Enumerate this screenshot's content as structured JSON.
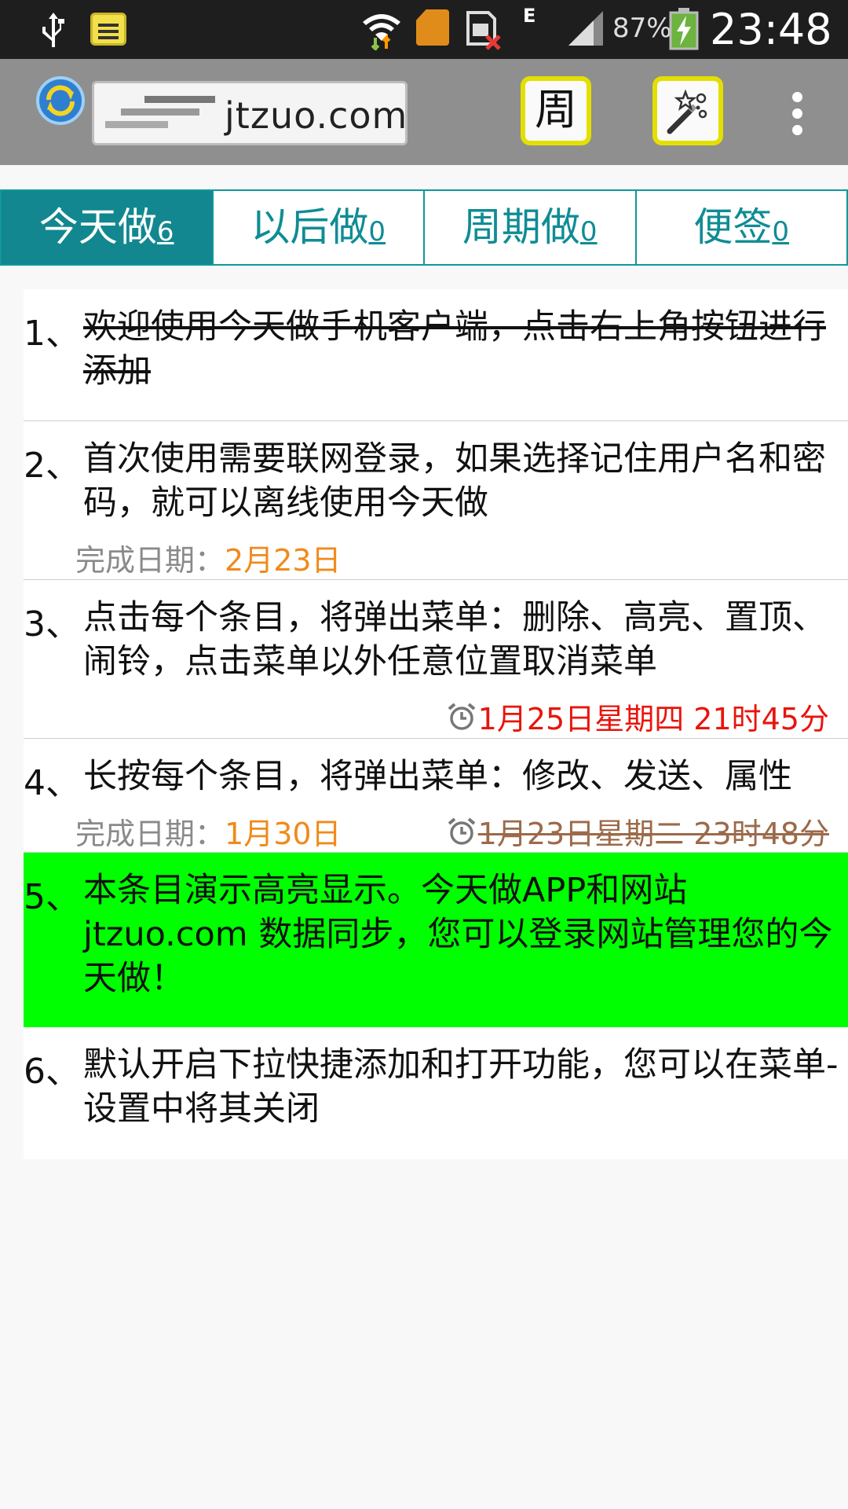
{
  "statusbar": {
    "network_type": "E",
    "battery_percent": "87%",
    "time": "23:48"
  },
  "appbar": {
    "site_name": "jtzuo.com",
    "week_button_label": "周"
  },
  "tabs": [
    {
      "label": "今天做",
      "count": "6"
    },
    {
      "label": "以后做",
      "count": "0"
    },
    {
      "label": "周期做",
      "count": "0"
    },
    {
      "label": "便签",
      "count": "0"
    }
  ],
  "tasks": [
    {
      "num": "1、",
      "text": "欢迎使用今天做手机客户端，点击右上角按钮进行添加"
    },
    {
      "num": "2、",
      "text": "首次使用需要联网登录，如果选择记住用户名和密码，就可以离线使用今天做",
      "due_label": "完成日期：",
      "due_date": "2月23日"
    },
    {
      "num": "3、",
      "text": "点击每个条目，将弹出菜单：删除、高亮、置顶、闹铃，点击菜单以外任意位置取消菜单",
      "alarm": "1月25日星期四 21时45分"
    },
    {
      "num": "4、",
      "text": "长按每个条目，将弹出菜单：修改、发送、属性",
      "due_label": "完成日期：",
      "due_date": "1月30日",
      "alarm": "1月23日星期二 23时48分"
    },
    {
      "num": "5、",
      "text": "本条目演示高亮显示。今天做APP和网站jtzuo.com 数据同步，您可以登录网站管理您的今天做！"
    },
    {
      "num": "6、",
      "text": "默认开启下拉快捷添加和打开功能，您可以在菜单-设置中将其关闭"
    }
  ],
  "colors": {
    "tab_accent": "#12878f",
    "highlight": "#00ff00",
    "due_date": "#f08a1a",
    "alarm": "#e8150c",
    "button_border": "#e3e000"
  }
}
